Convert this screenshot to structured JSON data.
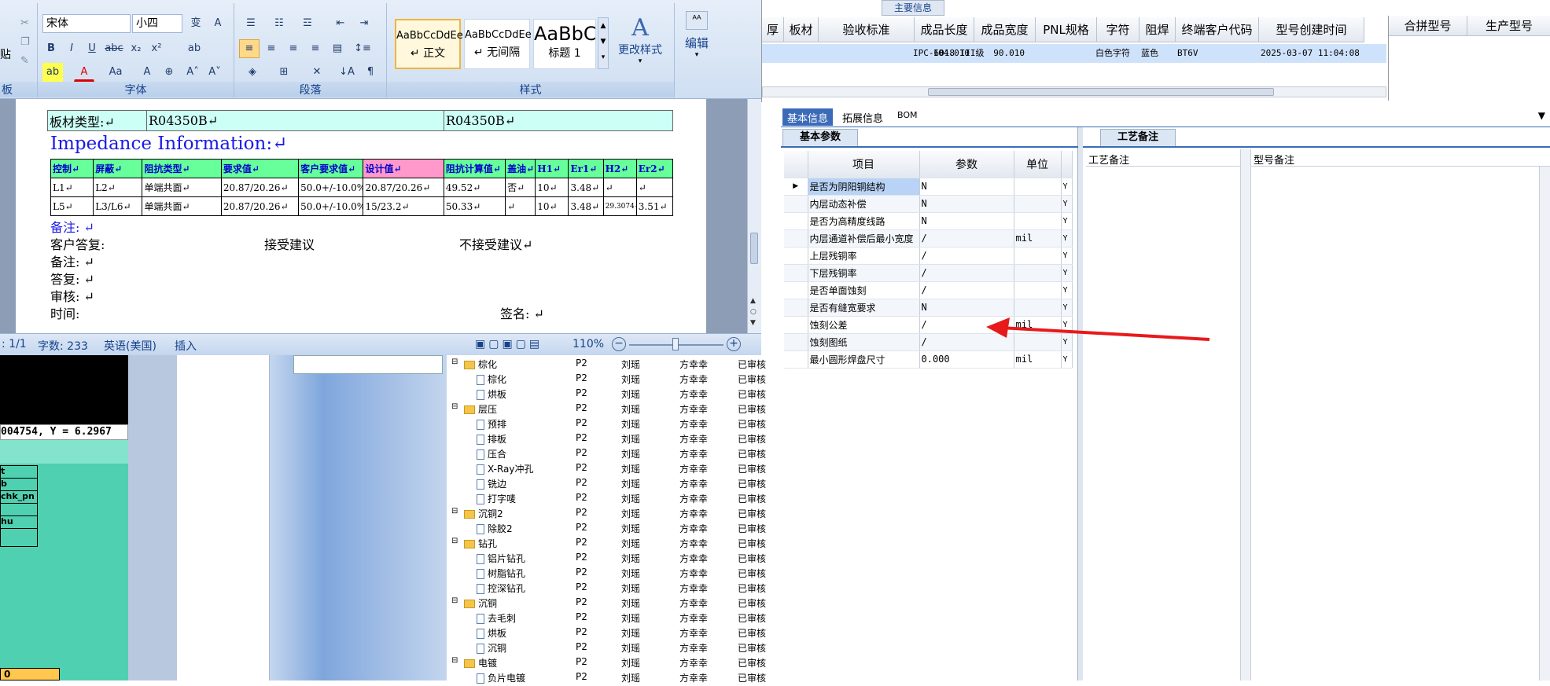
{
  "ribbon": {
    "font_name": "宋体",
    "font_size": "小四",
    "groups": {
      "clipboard": "板",
      "font": "字体",
      "paragraph": "段落",
      "styles": "样式"
    },
    "styles": [
      {
        "preview": "AaBbCcDdEe",
        "name": "↵ 正文"
      },
      {
        "preview": "AaBbCcDdEe",
        "name": "↵ 无间隔"
      },
      {
        "preview": "AaBbC",
        "name": "标题 1"
      }
    ],
    "change_styles": "更改样式",
    "edit": "编辑",
    "paste_frag": "贴"
  },
  "document": {
    "board_type_label": "板材类型:↵",
    "board_type_val1": "R04350B↵",
    "board_type_val2": "R04350B↵",
    "impedance_title": "Impedance Information:↵",
    "headers": [
      "控制↵",
      "屏蔽↵",
      "阻抗类型↵",
      "要求值↵",
      "客户要求值↵",
      "设计值↵",
      "阻抗计算值↵",
      "盖油↵",
      "H1↵",
      "Er1↵",
      "H2↵",
      "Er2↵"
    ],
    "rows": [
      [
        "L1↵",
        "L2↵",
        "单端共面↵",
        "20.87/20.26↵",
        "50.0+/-10.0%",
        "20.87/20.26↵",
        "49.52↵",
        "否↵",
        "10↵",
        "3.48↵",
        "↵",
        "↵"
      ],
      [
        "L5↵",
        "L3/L6↵",
        "单端共面↵",
        "20.87/20.26↵",
        "50.0+/-10.0%",
        "15/23.2↵",
        "50.33↵",
        "↵",
        "10↵",
        "3.48↵",
        "29.3074↵",
        "3.51↵"
      ]
    ],
    "remark1": "备注: ↵",
    "customer_reply": "客户答复:",
    "accept": "接受建议",
    "reject": "不接受建议↵",
    "remark2": "备注: ↵",
    "reply": "答复: ↵",
    "review": "审核: ↵",
    "time": "时间:",
    "sign": "签名: ↵"
  },
  "status_bar": {
    "page": ": 1/1",
    "words": "字数: 233",
    "lang": "英语(美国)",
    "mode": "插入",
    "zoom": "110%"
  },
  "left_panel": {
    "coord": "004754, Y = 6.2967",
    "items": [
      "t",
      "b",
      "chk_pn",
      "",
      "hu",
      ""
    ],
    "bottom": "0"
  },
  "top_grid": {
    "group_header": "主要信息",
    "headers": [
      "厚",
      "板材",
      "验收标准",
      "成品长度",
      "成品宽度",
      "PNL规格",
      "字符",
      "阻焊",
      "终端客户代码",
      "型号创建时间",
      "合拼型号",
      "生产型号"
    ],
    "row": [
      "",
      "",
      "IPC-6018 III级",
      "104.010",
      "90.010",
      "",
      "白色字符",
      "蓝色",
      "BT6V",
      "2025-03-07 11:04:08"
    ]
  },
  "tabs": [
    "基本信息",
    "拓展信息",
    "BOM"
  ],
  "subtabs": {
    "basic": "基本参数",
    "craft": "工艺备注"
  },
  "params": {
    "headers": [
      "项目",
      "参数",
      "单位"
    ],
    "rows": [
      [
        "是否为阴阳铜结构",
        "N",
        "",
        "Y"
      ],
      [
        "内层动态补偿",
        "N",
        "",
        "Y"
      ],
      [
        "是否为高精度线路",
        "N",
        "",
        "Y"
      ],
      [
        "内层通道补偿后最小宽度",
        "/",
        "mil",
        "Y"
      ],
      [
        "上层残铜率",
        "/",
        "",
        "Y"
      ],
      [
        "下层残铜率",
        "/",
        "",
        "Y"
      ],
      [
        "是否单面蚀刻",
        "/",
        "",
        "Y"
      ],
      [
        "是否有缝宽要求",
        "N",
        "",
        "Y"
      ],
      [
        "蚀刻公差",
        "/",
        "mil",
        "Y"
      ],
      [
        "蚀刻图纸",
        "/",
        "",
        "Y"
      ],
      [
        "最小圆形焊盘尺寸",
        "0.000",
        "mil",
        "Y"
      ]
    ]
  },
  "notes": {
    "craft": "工艺备注",
    "model": "型号备注"
  },
  "tree": [
    {
      "lvl": 0,
      "name": "棕化",
      "c1": "P2",
      "c2": "刘瑶",
      "c3": "方幸幸",
      "c4": "已审核"
    },
    {
      "lvl": 1,
      "name": "棕化",
      "c1": "P2",
      "c2": "刘瑶",
      "c3": "方幸幸",
      "c4": "已审核"
    },
    {
      "lvl": 1,
      "name": "烘板",
      "c1": "P2",
      "c2": "刘瑶",
      "c3": "方幸幸",
      "c4": "已审核"
    },
    {
      "lvl": 0,
      "name": "层压",
      "c1": "P2",
      "c2": "刘瑶",
      "c3": "方幸幸",
      "c4": "已审核"
    },
    {
      "lvl": 1,
      "name": "预排",
      "c1": "P2",
      "c2": "刘瑶",
      "c3": "方幸幸",
      "c4": "已审核"
    },
    {
      "lvl": 1,
      "name": "排板",
      "c1": "P2",
      "c2": "刘瑶",
      "c3": "方幸幸",
      "c4": "已审核"
    },
    {
      "lvl": 1,
      "name": "压合",
      "c1": "P2",
      "c2": "刘瑶",
      "c3": "方幸幸",
      "c4": "已审核"
    },
    {
      "lvl": 1,
      "name": "X-Ray冲孔",
      "c1": "P2",
      "c2": "刘瑶",
      "c3": "方幸幸",
      "c4": "已审核"
    },
    {
      "lvl": 1,
      "name": "铣边",
      "c1": "P2",
      "c2": "刘瑶",
      "c3": "方幸幸",
      "c4": "已审核"
    },
    {
      "lvl": 1,
      "name": "打字唛",
      "c1": "P2",
      "c2": "刘瑶",
      "c3": "方幸幸",
      "c4": "已审核"
    },
    {
      "lvl": 0,
      "name": "沉铜2",
      "c1": "P2",
      "c2": "刘瑶",
      "c3": "方幸幸",
      "c4": "已审核"
    },
    {
      "lvl": 1,
      "name": "除胶2",
      "c1": "P2",
      "c2": "刘瑶",
      "c3": "方幸幸",
      "c4": "已审核"
    },
    {
      "lvl": 0,
      "name": "钻孔",
      "c1": "P2",
      "c2": "刘瑶",
      "c3": "方幸幸",
      "c4": "已审核"
    },
    {
      "lvl": 1,
      "name": "铝片钻孔",
      "c1": "P2",
      "c2": "刘瑶",
      "c3": "方幸幸",
      "c4": "已审核"
    },
    {
      "lvl": 1,
      "name": "树脂钻孔",
      "c1": "P2",
      "c2": "刘瑶",
      "c3": "方幸幸",
      "c4": "已审核"
    },
    {
      "lvl": 1,
      "name": "控深钻孔",
      "c1": "P2",
      "c2": "刘瑶",
      "c3": "方幸幸",
      "c4": "已审核"
    },
    {
      "lvl": 0,
      "name": "沉铜",
      "c1": "P2",
      "c2": "刘瑶",
      "c3": "方幸幸",
      "c4": "已审核"
    },
    {
      "lvl": 1,
      "name": "去毛刺",
      "c1": "P2",
      "c2": "刘瑶",
      "c3": "方幸幸",
      "c4": "已审核"
    },
    {
      "lvl": 1,
      "name": "烘板",
      "c1": "P2",
      "c2": "刘瑶",
      "c3": "方幸幸",
      "c4": "已审核"
    },
    {
      "lvl": 1,
      "name": "沉铜",
      "c1": "P2",
      "c2": "刘瑶",
      "c3": "方幸幸",
      "c4": "已审核"
    },
    {
      "lvl": 0,
      "name": "电镀",
      "c1": "P2",
      "c2": "刘瑶",
      "c3": "方幸幸",
      "c4": "已审核"
    },
    {
      "lvl": 1,
      "name": "负片电镀",
      "c1": "P2",
      "c2": "刘瑶",
      "c3": "方幸幸",
      "c4": "已审核"
    }
  ],
  "colors": {
    "accent": "#3b6bb8",
    "arrow": "#e8191b",
    "teal": "#4fd0b0"
  }
}
